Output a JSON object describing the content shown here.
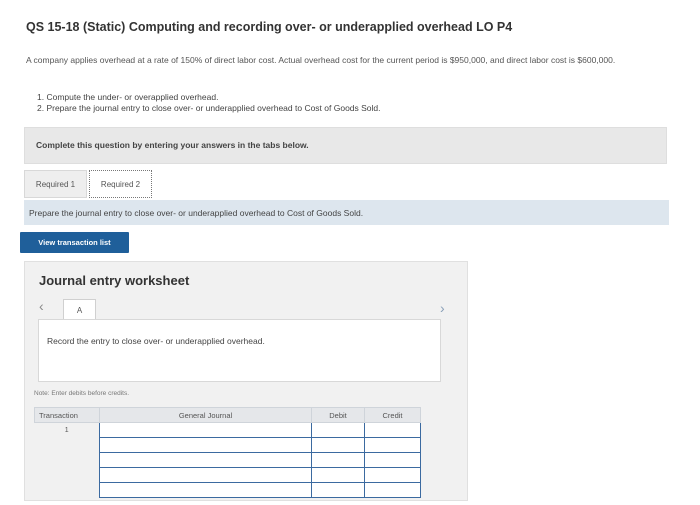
{
  "header": {
    "title": "QS 15-18 (Static) Computing and recording over- or underapplied overhead LO P4"
  },
  "question": {
    "intro": "A company applies overhead at a rate of 150% of direct labor cost. Actual overhead cost for the current period is $950,000, and direct labor cost is $600,000.",
    "task1": "1. Compute the under- or overapplied overhead.",
    "task2": "2. Prepare the journal entry to close over- or underapplied overhead to Cost of Goods Sold."
  },
  "complete_bar": {
    "text": "Complete this question by entering your answers in the tabs below."
  },
  "tabs": [
    {
      "label": "Required 1"
    },
    {
      "label": "Required 2"
    }
  ],
  "instruction": {
    "text": "Prepare the journal entry to close over- or underapplied overhead to Cost of Goods Sold."
  },
  "view_button": {
    "label": "View transaction list"
  },
  "journal": {
    "title": "Journal entry worksheet",
    "page_tab": "A",
    "record_text": "Record the entry to close over- or underapplied overhead.",
    "note": "Note: Enter debits before credits.",
    "columns": {
      "transaction": "Transaction",
      "general_journal": "General Journal",
      "debit": "Debit",
      "credit": "Credit"
    },
    "rows": [
      {
        "transaction": "1"
      }
    ]
  },
  "colors": {
    "button_bg": "#1f5f9a",
    "instruction_bg": "#dde6ee",
    "panel_bg": "#f1f1f1"
  }
}
